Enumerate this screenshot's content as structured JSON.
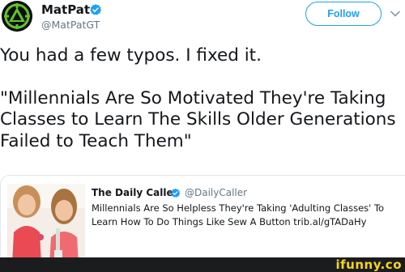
{
  "tweet": {
    "author_name": "MatPat",
    "author_handle": "@MatPatGT",
    "follow_label": "Follow",
    "text_line1": "You had a few typos. I fixed it.",
    "text_quote": "\"Millennials Are So Motivated They're Taking Classes to Learn The Skills Older Generations Failed to Teach Them\""
  },
  "quoted_card": {
    "author_name": "The Daily Caller",
    "author_handle": "@DailyCaller",
    "text": "Millennials Are So Helpless They're Taking 'Adulting Classes' To Learn How To Do Things Like Sew A Button trib.al/gTADaHy"
  },
  "watermark": {
    "text": "ifunny.co"
  },
  "colors": {
    "accent": "#1da1f2",
    "text_primary": "#14171a",
    "text_secondary": "#657786",
    "watermark_yellow": "#f8d51c",
    "watermark_bar": "#1b1c1e"
  },
  "icons": {
    "avatar": "game-theory-logo",
    "verified": "verified-badge-icon",
    "menu": "chevron-down-icon"
  }
}
